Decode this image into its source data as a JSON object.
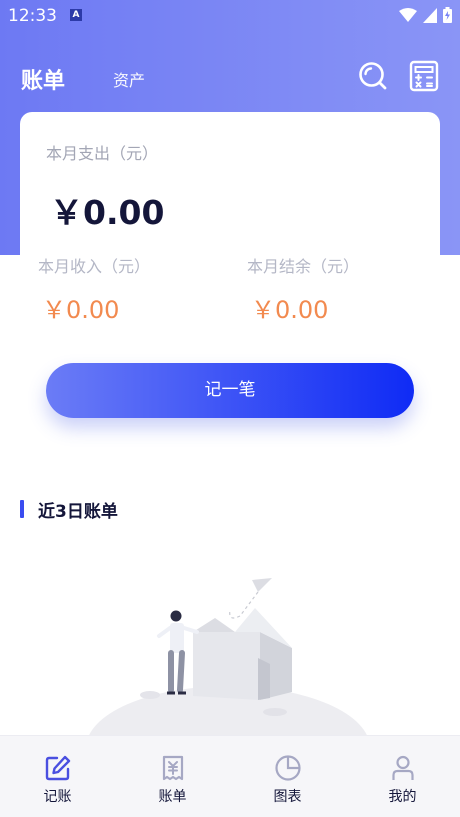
{
  "status": {
    "time": "12:33",
    "notification_badge": "A"
  },
  "header": {
    "title": "账单",
    "assets_tab": "资产"
  },
  "summary": {
    "expense_label": "本月支出（元）",
    "expense_value": "￥0.00",
    "income_label": "本月收入（元）",
    "income_value": "￥0.00",
    "balance_label": "本月结余（元）",
    "balance_value": "￥0.00"
  },
  "record_button": "记一笔",
  "recent": {
    "title": "近3日账单"
  },
  "nav": {
    "items": [
      {
        "label": "记账",
        "icon": "edit-icon",
        "active": true
      },
      {
        "label": "账单",
        "icon": "receipt-icon",
        "active": false
      },
      {
        "label": "图表",
        "icon": "pie-chart-icon",
        "active": false
      },
      {
        "label": "我的",
        "icon": "user-icon",
        "active": false
      }
    ]
  },
  "colors": {
    "header": "#7782f4",
    "accent": "#1a33f5",
    "amount": "#f28a4f"
  }
}
